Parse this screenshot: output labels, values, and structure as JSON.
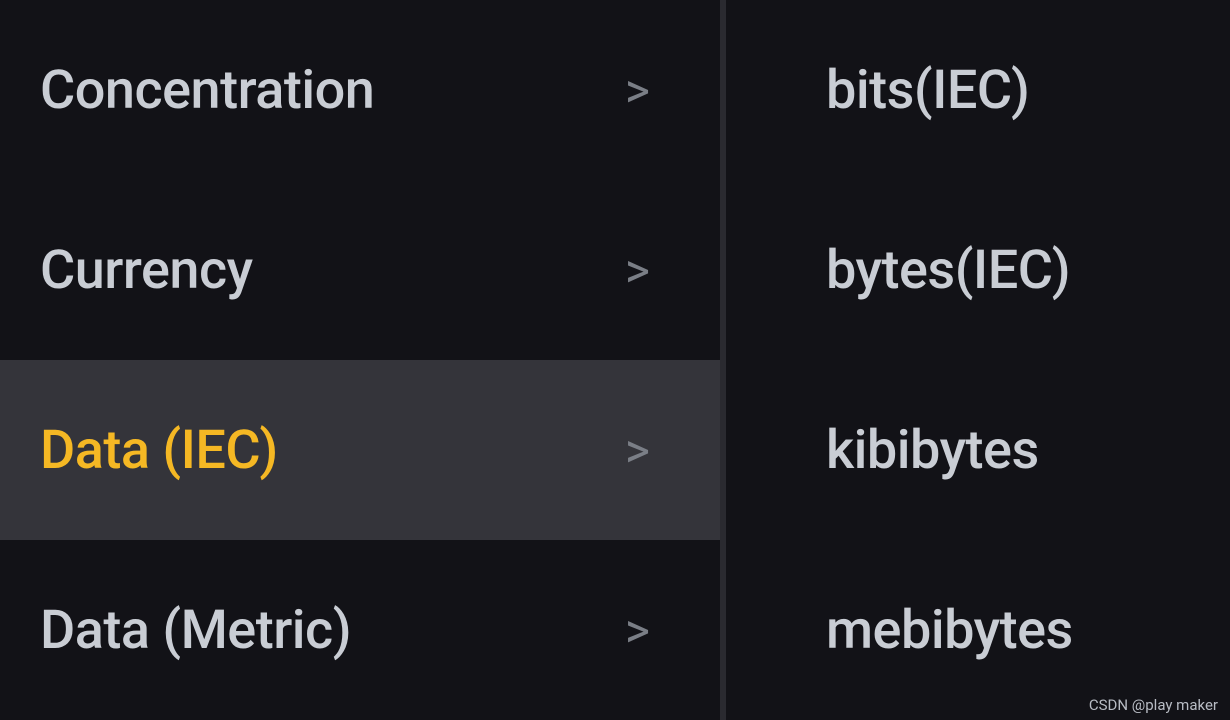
{
  "categories": [
    {
      "label": "Concentration",
      "selected": false
    },
    {
      "label": "Currency",
      "selected": false
    },
    {
      "label": "Data (IEC)",
      "selected": true
    },
    {
      "label": "Data (Metric)",
      "selected": false
    }
  ],
  "units": [
    {
      "label": "bits(IEC)"
    },
    {
      "label": "bytes(IEC)"
    },
    {
      "label": "kibibytes"
    },
    {
      "label": "mebibytes"
    }
  ],
  "watermark": "CSDN @play maker"
}
